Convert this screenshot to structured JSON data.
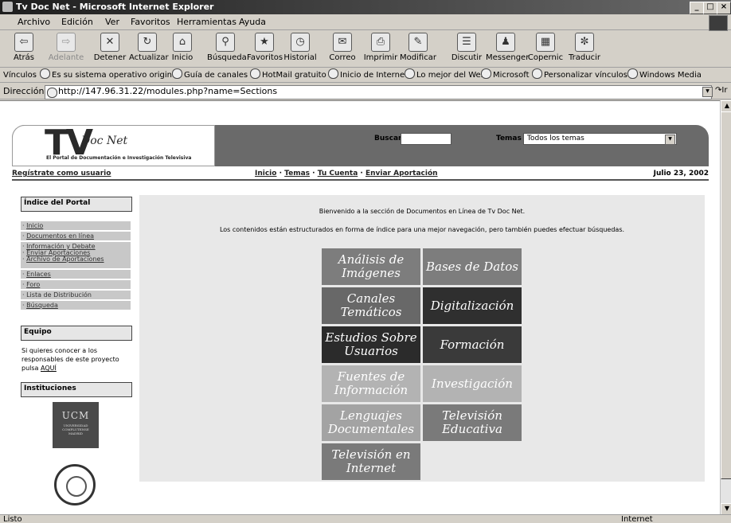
{
  "window": {
    "title": "Tv Doc Net - Microsoft Internet Explorer"
  },
  "menu": [
    "Archivo",
    "Edición",
    "Ver",
    "Favoritos",
    "Herramientas",
    "Ayuda"
  ],
  "toolbar": [
    {
      "label": "Atrás",
      "icon": "back-arrow-icon",
      "enabled": true
    },
    {
      "label": "Adelante",
      "icon": "forward-arrow-icon",
      "enabled": false
    },
    {
      "label": "Detener",
      "icon": "stop-icon",
      "enabled": true
    },
    {
      "label": "Actualizar",
      "icon": "refresh-icon",
      "enabled": true
    },
    {
      "label": "Inicio",
      "icon": "home-icon",
      "enabled": true
    },
    {
      "label": "Búsqueda",
      "icon": "search-icon",
      "enabled": true
    },
    {
      "label": "Favoritos",
      "icon": "favorites-icon",
      "enabled": true
    },
    {
      "label": "Historial",
      "icon": "history-icon",
      "enabled": true
    },
    {
      "label": "Correo",
      "icon": "mail-icon",
      "enabled": true
    },
    {
      "label": "Imprimir",
      "icon": "print-icon",
      "enabled": true
    },
    {
      "label": "Modificar",
      "icon": "edit-icon",
      "enabled": true
    },
    {
      "label": "Discutir",
      "icon": "discuss-icon",
      "enabled": true
    },
    {
      "label": "Messenger",
      "icon": "messenger-icon",
      "enabled": true
    },
    {
      "label": "Copernic",
      "icon": "copernic-icon",
      "enabled": true
    },
    {
      "label": "Traducir",
      "icon": "translate-icon",
      "enabled": true
    }
  ],
  "links_bar": {
    "label": "Vínculos",
    "items": [
      "Es su sistema operativo original",
      "Guía de canales",
      "HotMail gratuito",
      "Inicio de Internet",
      "Lo mejor del Web",
      "Microsoft",
      "Personalizar vínculos",
      "Windows Media"
    ]
  },
  "address": {
    "label": "Dirección",
    "url": "http://147.96.31.22/modules.php?name=Sections",
    "go": "Ir"
  },
  "status": {
    "left": "Listo",
    "zone": "Internet"
  },
  "page": {
    "logo": {
      "main": "TV",
      "sub": "Doc Net",
      "tagline": "El Portal de Documentación e Investigación Televisiva"
    },
    "search_label": "Buscar",
    "search_value": "",
    "topics_label": "Temas",
    "topics_value": "Todos los temas",
    "register_link": "Regístrate como usuario",
    "nav": [
      "Inicio",
      "Temas",
      "Tu Cuenta",
      "Enviar Aportación"
    ],
    "date": "Julio 23, 2002",
    "sidebar": {
      "index_title": "Índice del Portal",
      "items": [
        "Inicio",
        "Documentos en línea",
        "Información y Debate",
        "Enviar Aportaciones",
        "Archivo de Aportaciones",
        "Enlaces",
        "Foro",
        "Lista de Distribución",
        "Búsqueda"
      ],
      "team_title": "Equipo",
      "team_text": "Si quieres conocer a los responsables de este proyecto pulsa",
      "team_link": "AQUÍ",
      "institutions_title": "Instituciones",
      "ucm_logo": {
        "main": "UCM",
        "lines": [
          "UNIVERSIDAD",
          "COMPLUTENSE",
          "MADRID"
        ]
      }
    },
    "welcome": "Bienvenido a la sección de Documentos en Línea de Tv Doc Net.",
    "intro": "Los contenidos están estructurados en forma de índice para una mejor navegación, pero también puedes efectuar búsquedas.",
    "tiles": [
      {
        "label": "Análisis de Imágenes",
        "color": "#7d7d7d"
      },
      {
        "label": "Bases de Datos",
        "color": "#7d7d7d"
      },
      {
        "label": "Canales Temáticos",
        "color": "#686868"
      },
      {
        "label": "Digitalización",
        "color": "#2f2f2f"
      },
      {
        "label": "Estudios Sobre Usuarios",
        "color": "#2b2b2b"
      },
      {
        "label": "Formación",
        "color": "#3a3a3a"
      },
      {
        "label": "Fuentes de Información",
        "color": "#b3b3b3"
      },
      {
        "label": "Investigación",
        "color": "#b3b3b3"
      },
      {
        "label": "Lenguajes Documentales",
        "color": "#a3a3a3"
      },
      {
        "label": "Televisión Educativa",
        "color": "#7a7a7a"
      },
      {
        "label": "Televisión en Internet",
        "color": "#7a7a7a"
      }
    ]
  }
}
